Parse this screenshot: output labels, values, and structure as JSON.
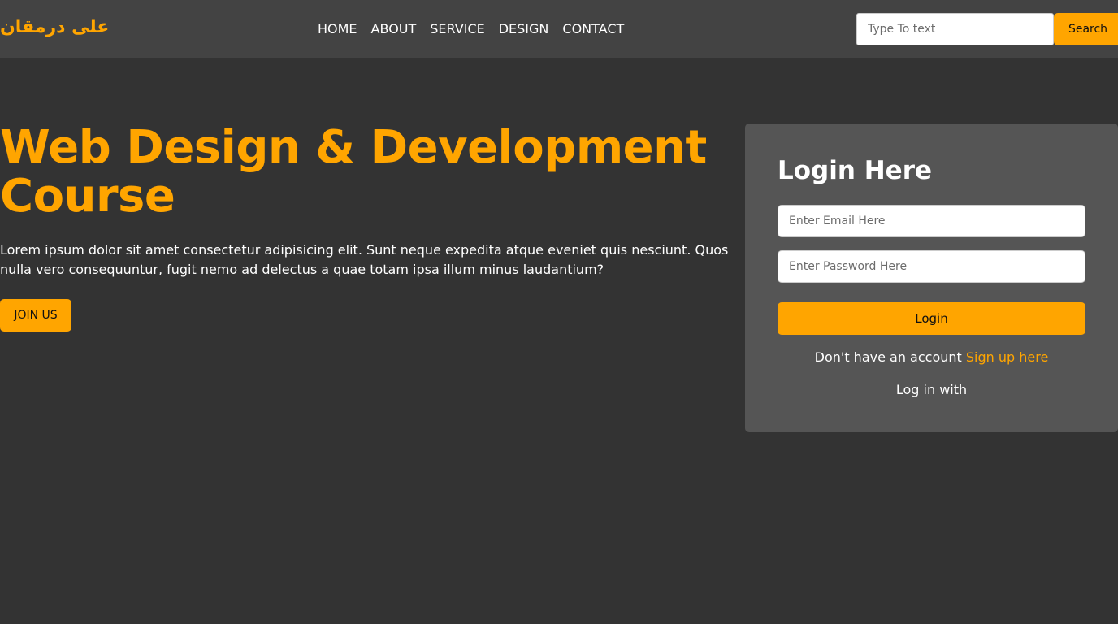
{
  "header": {
    "logo": "علی درمقان",
    "nav": [
      {
        "label": "HOME"
      },
      {
        "label": "ABOUT"
      },
      {
        "label": "SERVICE"
      },
      {
        "label": "DESIGN"
      },
      {
        "label": "CONTACT"
      }
    ],
    "search": {
      "placeholder": "Type To text",
      "value": "",
      "button_label": "Search"
    }
  },
  "hero": {
    "title_line1": "Web Design & Development",
    "title_line2": "Course",
    "description": "Lorem ipsum dolor sit amet consectetur adipisicing elit. Sunt neque expedita atque eveniet quis nesciunt. Quos nulla vero consequuntur, fugit nemo ad delectus a quae totam ipsa illum minus laudantium?",
    "cta_label": "JOIN US"
  },
  "login": {
    "title": "Login Here",
    "email_placeholder": "Enter Email Here",
    "password_placeholder": "Enter Password Here",
    "button_label": "Login",
    "no_account_text": "Don't have an account",
    "signup_link": "Sign up here",
    "login_with_text": "Log in with"
  },
  "colors": {
    "accent": "#ffa500",
    "page_background": "#333333",
    "header_background": "#434343",
    "card_background": "#555555"
  }
}
